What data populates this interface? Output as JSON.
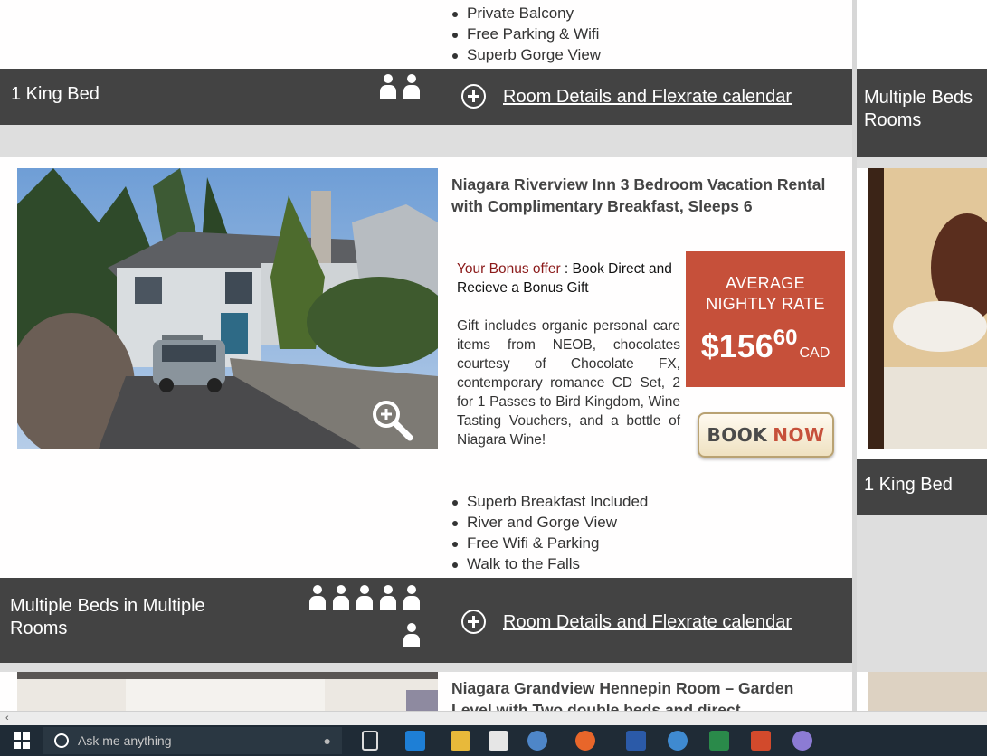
{
  "top_listing": {
    "features": [
      "Private Balcony",
      "Free Parking & Wifi",
      "Superb Gorge View"
    ],
    "bed_type": "1 King Bed",
    "details_link": "Room Details and Flexrate calendar",
    "guests": 2
  },
  "listing": {
    "title": "Niagara Riverview Inn 3 Bedroom Vacation Rental with Complimentary Breakfast, Sleeps 6",
    "bonus_label": "Your Bonus offer",
    "bonus_text": " : Book Direct and Recieve a Bonus Gift",
    "gift_text": "Gift includes organic personal care items from NEOB, chocolates courtesy of Chocolate FX, contemporary romance CD Set, 2 for 1 Passes to Bird Kingdom, Wine Tasting Vouchers, and a bottle of Niagara Wine!",
    "rate_label_line1": "AVERAGE",
    "rate_label_line2": "NIGHTLY RATE",
    "price_dollars": "$156",
    "price_cents": "60",
    "currency": "CAD",
    "book_label_1": "BOOK",
    "book_label_2": "NOW",
    "features": [
      "Superb Breakfast Included",
      "River and Gorge View",
      "Free Wifi & Parking",
      "Walk to the Falls"
    ],
    "bed_type": "Multiple Beds in Multiple Rooms",
    "details_link": "Room Details and Flexrate calendar",
    "guests": 6
  },
  "next_listing": {
    "title_line1": "Niagara Grandview Hennepin Room – Garden",
    "title_line2": "Level with Two double beds and direct"
  },
  "right_column": {
    "bar1": "Multiple Beds Rooms",
    "bar2": "1 King Bed"
  },
  "taskbar": {
    "search_placeholder": "Ask me anything"
  },
  "colors": {
    "bar": "#434343",
    "rate_box": "#c6503a",
    "taskbar": "#1f2b36"
  }
}
